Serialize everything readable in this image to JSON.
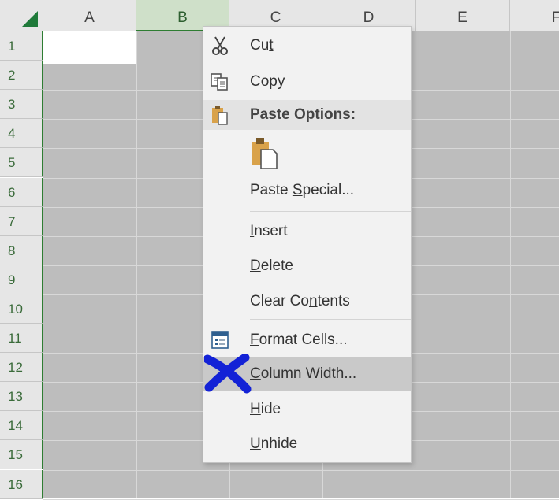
{
  "columns": [
    "A",
    "B",
    "C",
    "D",
    "E",
    "F"
  ],
  "selected_column": "B",
  "rows": [
    "1",
    "2",
    "3",
    "4",
    "5",
    "6",
    "7",
    "8",
    "9",
    "10",
    "11",
    "12",
    "13",
    "14",
    "15",
    "16"
  ],
  "context_menu": {
    "items": [
      {
        "id": "cut",
        "pre": "Cu",
        "acc": "t",
        "post": "",
        "icon": "scissors-icon"
      },
      {
        "id": "copy",
        "pre": "",
        "acc": "C",
        "post": "opy",
        "icon": "copy-icon"
      },
      {
        "id": "paste_options",
        "text": "Paste Options:",
        "icon": "clipboard-icon"
      },
      {
        "id": "paste_special",
        "pre": "Paste ",
        "acc": "S",
        "post": "pecial...",
        "icon": ""
      },
      {
        "id": "insert",
        "pre": "",
        "acc": "I",
        "post": "nsert",
        "icon": ""
      },
      {
        "id": "delete",
        "pre": "",
        "acc": "D",
        "post": "elete",
        "icon": ""
      },
      {
        "id": "clear_contents",
        "pre": "Clear Co",
        "acc": "n",
        "post": "tents",
        "icon": ""
      },
      {
        "id": "format_cells",
        "pre": "",
        "acc": "F",
        "post": "ormat Cells...",
        "icon": "format-cells-icon"
      },
      {
        "id": "column_width",
        "pre": "",
        "acc": "C",
        "post": "olumn Width...",
        "icon": ""
      },
      {
        "id": "hide",
        "pre": "",
        "acc": "H",
        "post": "ide",
        "icon": ""
      },
      {
        "id": "unhide",
        "pre": "",
        "acc": "U",
        "post": "nhide",
        "icon": ""
      }
    ],
    "highlighted_item": "column_width"
  },
  "colors": {
    "accent_green": "#1f7a3a",
    "annotation_blue": "#1322d6",
    "grid_gray": "#bdbdbd"
  }
}
